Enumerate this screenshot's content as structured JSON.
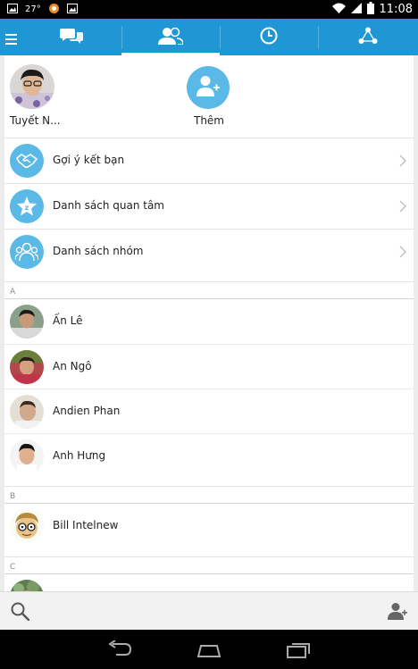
{
  "status_bar": {
    "temperature": "27°",
    "time": "11:08",
    "icons": [
      "image-icon",
      "weather-icon",
      "app-icon",
      "gallery-icon",
      "wifi-icon",
      "signal-icon",
      "battery-icon"
    ]
  },
  "tabs": [
    {
      "name": "messages",
      "icon": "chat-bubbles-icon",
      "active": false
    },
    {
      "name": "contacts",
      "icon": "contacts-icon",
      "active": true
    },
    {
      "name": "history",
      "icon": "clock-icon",
      "active": false
    },
    {
      "name": "more",
      "icon": "share-icon",
      "active": false
    }
  ],
  "profile": {
    "name": "Tuyết N..."
  },
  "add_button": {
    "label": "Thêm"
  },
  "menu": [
    {
      "label": "Gợi ý kết bạn",
      "icon": "handshake-icon"
    },
    {
      "label": "Danh sách quan tâm",
      "icon": "star-icon"
    },
    {
      "label": "Danh sách nhóm",
      "icon": "group-icon"
    }
  ],
  "sections": [
    {
      "letter": "A",
      "contacts": [
        {
          "name": "Ấn Lê"
        },
        {
          "name": "An Ngô"
        },
        {
          "name": "Andien Phan"
        },
        {
          "name": "Anh Hưng"
        }
      ]
    },
    {
      "letter": "B",
      "contacts": [
        {
          "name": "Bill Intelnew"
        }
      ]
    },
    {
      "letter": "C",
      "contacts": []
    }
  ],
  "colors": {
    "accent": "#1f97d4",
    "icon_circle": "#5ab9e6",
    "background": "#ececec"
  }
}
